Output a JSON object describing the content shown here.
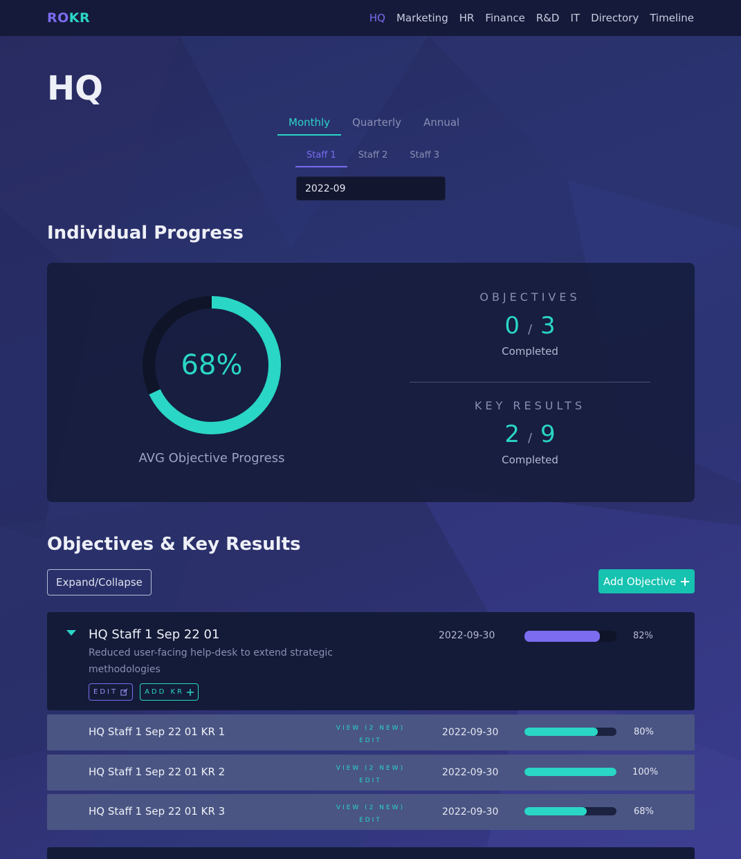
{
  "nav": {
    "brand_a": "RO",
    "brand_b": "KR",
    "links": [
      "HQ",
      "Marketing",
      "HR",
      "Finance",
      "R&D",
      "IT",
      "Directory",
      "Timeline"
    ]
  },
  "page": {
    "title": "HQ"
  },
  "period_tabs": [
    "Monthly",
    "Quarterly",
    "Annual"
  ],
  "staff_tabs": [
    "Staff 1",
    "Staff 2",
    "Staff 3"
  ],
  "date_field": {
    "value": "2022-09"
  },
  "progress": {
    "section_title": "Individual Progress",
    "avg_value": "68%",
    "avg_fraction": 0.68,
    "avg_caption": "AVG Objective Progress",
    "objectives": {
      "label": "OBJECTIVES",
      "done": "0",
      "total": "3",
      "sub": "Completed"
    },
    "key_results": {
      "label": "KEY RESULTS",
      "done": "2",
      "total": "9",
      "sub": "Completed"
    }
  },
  "okr": {
    "section_title": "Objectives & Key Results",
    "expand_label": "Expand/Collapse",
    "add_label": "Add Objective",
    "objective": {
      "title": "HQ Staff 1 Sep 22 01",
      "description": "Reduced user-facing help-desk to extend strategic methodologies",
      "date": "2022-09-30",
      "progress": 0.82,
      "progress_label": "82%",
      "edit_label": "EDIT",
      "add_kr_label": "ADD KR",
      "key_results": [
        {
          "title": "HQ Staff 1 Sep 22 01 KR 1",
          "view_label": "VIEW (2 NEW)",
          "edit_label": "EDIT",
          "date": "2022-09-30",
          "progress": 0.8,
          "progress_label": "80%"
        },
        {
          "title": "HQ Staff 1 Sep 22 01 KR 2",
          "view_label": "VIEW (2 NEW)",
          "edit_label": "EDIT",
          "date": "2022-09-30",
          "progress": 1.0,
          "progress_label": "100%"
        },
        {
          "title": "HQ Staff 1 Sep 22 01 KR 3",
          "view_label": "VIEW (2 NEW)",
          "edit_label": "EDIT",
          "date": "2022-09-30",
          "progress": 0.68,
          "progress_label": "68%"
        }
      ]
    }
  },
  "colors": {
    "teal": "#2ad6c6",
    "purple": "#7b6cf0"
  }
}
